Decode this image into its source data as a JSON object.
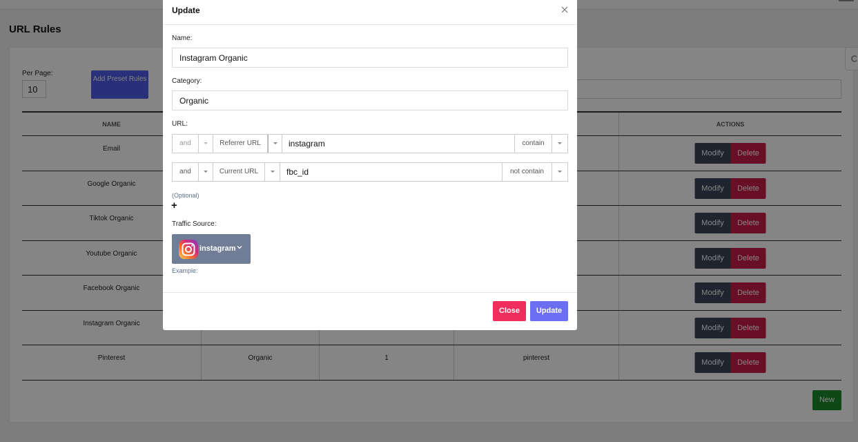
{
  "page": {
    "title": "URL Rules",
    "per_page_label": "Per Page:",
    "per_page_value": "10",
    "preset_button": "Add Preset Rules",
    "new_button": "New"
  },
  "table": {
    "headers": [
      "NAME",
      "",
      "",
      "",
      "ACTIONS"
    ],
    "modify_label": "Modify",
    "delete_label": "Delete",
    "rows": [
      {
        "name": "Email"
      },
      {
        "name": "Google Organic"
      },
      {
        "name": "Tiktok Organic"
      },
      {
        "name": "Youtube Organic"
      },
      {
        "name": "Facebook Organic"
      },
      {
        "name": "Instagram Organic"
      },
      {
        "name": "Pinterest",
        "category": "Organic",
        "priority": "1",
        "source": "pinterest"
      }
    ]
  },
  "modal": {
    "title": "Update",
    "name_label": "Name:",
    "name_value": "Instagram Organic",
    "category_label": "Category:",
    "category_value": "Organic",
    "url_label": "URL:",
    "url_rules": [
      {
        "logic": "and",
        "field": "Referrer URL",
        "value": "instagram",
        "operator": "contain"
      },
      {
        "logic": "and",
        "field": "Current URL",
        "value": "fbc_id",
        "operator": "not contain"
      }
    ],
    "optional_label": "(Optional)",
    "add_symbol": "+",
    "traffic_source_label": "Traffic Source:",
    "traffic_source_value": "instagram",
    "example_label": "Example:",
    "close_button": "Close",
    "update_button": "Update"
  },
  "colors": {
    "primary": "#6b6ef0",
    "danger": "#ef2e5e",
    "delete": "#c81e4a",
    "modify": "#3b4758",
    "success": "#1c8a2c"
  }
}
